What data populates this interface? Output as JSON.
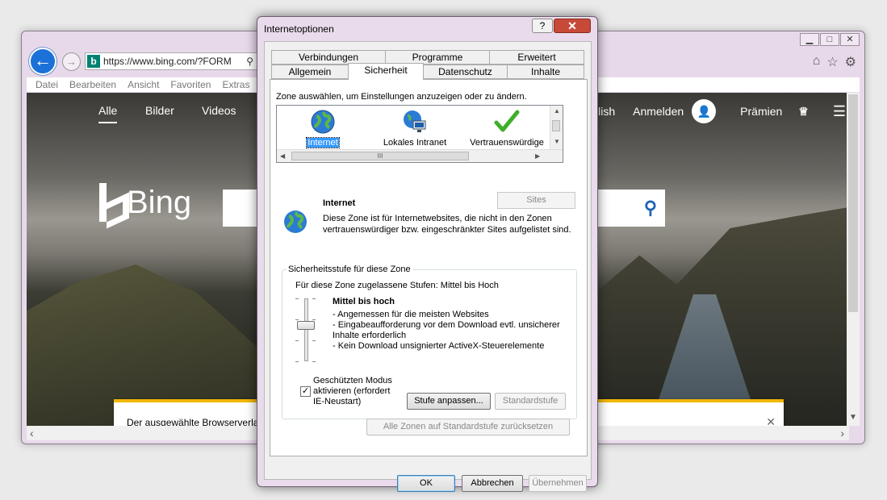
{
  "browser": {
    "address": "https://www.bing.com/?FORM",
    "menu": [
      "Datei",
      "Bearbeiten",
      "Ansicht",
      "Favoriten",
      "Extras"
    ],
    "bing_nav": [
      "Alle",
      "Bilder",
      "Videos"
    ],
    "bing_logo_text": "Bing",
    "signin_lang": "glish",
    "signin": "Anmelden",
    "rewards": "Prämien",
    "notification": "Der ausgewählte Browserverlauf"
  },
  "dialog": {
    "title": "Internetoptionen",
    "help": "?",
    "tabs_row1": [
      "Verbindungen",
      "Programme",
      "Erweitert"
    ],
    "tabs_row2": [
      "Allgemein",
      "Sicherheit",
      "Datenschutz",
      "Inhalte"
    ],
    "zone_prompt": "Zone auswählen, um Einstellungen anzuzeigen oder zu ändern.",
    "zones": [
      "Internet",
      "Lokales Intranet",
      "Vertrauenswürdige"
    ],
    "scroll_grip": "III",
    "sites_button": "Sites",
    "zone_title": "Internet",
    "zone_description": "Diese Zone ist für Internetwebsites, die nicht in den Zonen vertrauenswürdiger bzw. eingeschränkter Sites aufgelistet sind.",
    "level_legend": "Sicherheitsstufe für diese Zone",
    "level_allowed": "Für diese Zone zugelassene Stufen: Mittel bis Hoch",
    "level_name": "Mittel bis hoch",
    "level_lines": [
      "- Angemessen für die meisten Websites",
      "- Eingabeaufforderung vor dem Download evtl. unsicherer Inhalte erforderlich",
      "- Kein Download unsignierter ActiveX-Steuerelemente"
    ],
    "protected_mode": "Geschützten Modus aktivieren (erfordert IE-Neustart)",
    "protected_mode_checked": true,
    "custom_level_button": "Stufe anpassen...",
    "default_level_button": "Standardstufe",
    "reset_all_button": "Alle Zonen auf Standardstufe zurücksetzen",
    "ok": "OK",
    "cancel": "Abbrechen",
    "apply": "Übernehmen"
  }
}
